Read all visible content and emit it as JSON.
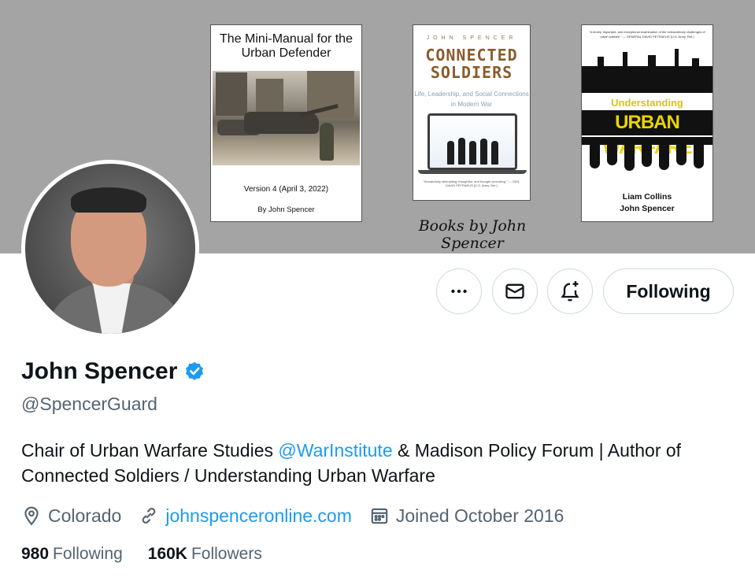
{
  "banner": {
    "caption": "Books by John Spencer",
    "book1": {
      "title": "The Mini-Manual for the Urban Defender",
      "version": "Version 4 (April 3, 2022)",
      "byline": "By John Spencer"
    },
    "book2": {
      "author": "JOHN SPENCER",
      "title": "CONNECTED SOLDIERS",
      "subtitle": "Life, Leadership, and Social Connections in Modern War",
      "blurb": "\"Wonderfully stimulating, thoughtful, and thought-provoking.\" — GEN. DAVID PETRAEUS (U.S. Army, Ret.)"
    },
    "book3": {
      "blurb": "\"A timely, important, and exceptional examination of the extraordinary challenges of urban warfare.\" — GENERAL DAVID PETRAEUS (U.S. Army, Ret.)",
      "title_top": "Understanding",
      "title_main": "URBAN WARFARE",
      "author1": "Liam Collins",
      "author2": "John Spencer"
    }
  },
  "actions": {
    "more_icon": "ellipsis-icon",
    "message_icon": "envelope-icon",
    "notify_icon": "bell-plus-icon",
    "following_label": "Following"
  },
  "profile": {
    "name": "John Spencer",
    "verified_icon": "verified-badge-icon",
    "handle": "@SpencerGuard",
    "bio_before": "Chair of Urban Warfare Studies ",
    "bio_mention": "@WarInstitute",
    "bio_after": " & Madison Policy Forum | Author of Connected Soldiers / Understanding Urban Warfare",
    "location": "Colorado",
    "website": "johnspenceronline.com",
    "joined": "Joined October 2016",
    "following_count": "980",
    "following_label": "Following",
    "followers_count": "160K",
    "followers_label": "Followers"
  },
  "colors": {
    "accent": "#1d9bf0",
    "secondary_text": "#536471",
    "primary_text": "#0f1419",
    "banner_bg": "#a4a4a4"
  }
}
